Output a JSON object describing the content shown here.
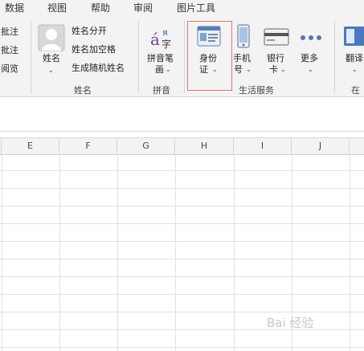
{
  "menu": {
    "items": [
      "数据",
      "视图",
      "帮助",
      "审阅",
      "图片工具"
    ]
  },
  "ribbon": {
    "annotate": {
      "top_label": "批注",
      "mid_label": "批注",
      "bottom_label": "阅览"
    },
    "name_group": {
      "name_button_label": "姓名",
      "split_label": "姓名分开",
      "space_label": "姓名加空格",
      "random_label": "生成随机姓名",
      "group_label": "姓名"
    },
    "pinyin_group": {
      "strokes_label_line1": "拼音笔",
      "strokes_label_line2": "画",
      "group_label": "拼音"
    },
    "life_group": {
      "id_line1": "身份",
      "id_line2": "证",
      "phone_line1": "手机",
      "phone_line2": "号",
      "bank_line1": "银行",
      "bank_line2": "卡",
      "more_label": "更多",
      "group_label": "生活服务"
    },
    "translate_group": {
      "translate_label": "翻译",
      "group_label_partial": "在"
    }
  },
  "grid": {
    "columns": [
      "E",
      "F",
      "G",
      "H",
      "I",
      "J"
    ]
  },
  "watermark": {
    "text": "Bai 经验"
  },
  "colors": {
    "highlight_border": "#e77373",
    "ribbon_bg": "#f3f3f3",
    "grid_line": "#e1e1e1"
  }
}
